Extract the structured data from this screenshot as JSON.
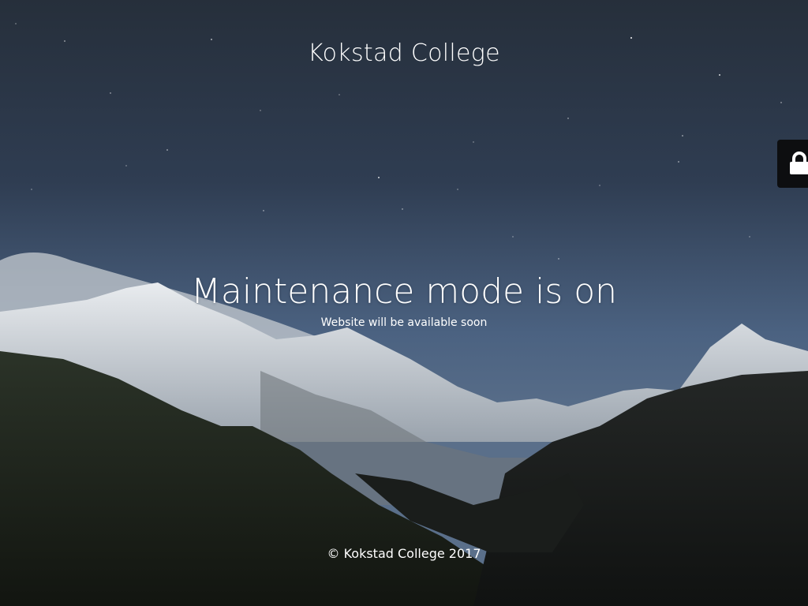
{
  "site": {
    "title": "Kokstad College"
  },
  "maintenance": {
    "headline": "Maintenance mode is on",
    "subline": "Website will be available soon"
  },
  "footer": {
    "copyright": "© Kokstad College 2017"
  },
  "login_tab": {
    "icon": "lock-icon"
  },
  "colors": {
    "text": "#ffffff",
    "login_tab_bg": "#0d0e10"
  }
}
